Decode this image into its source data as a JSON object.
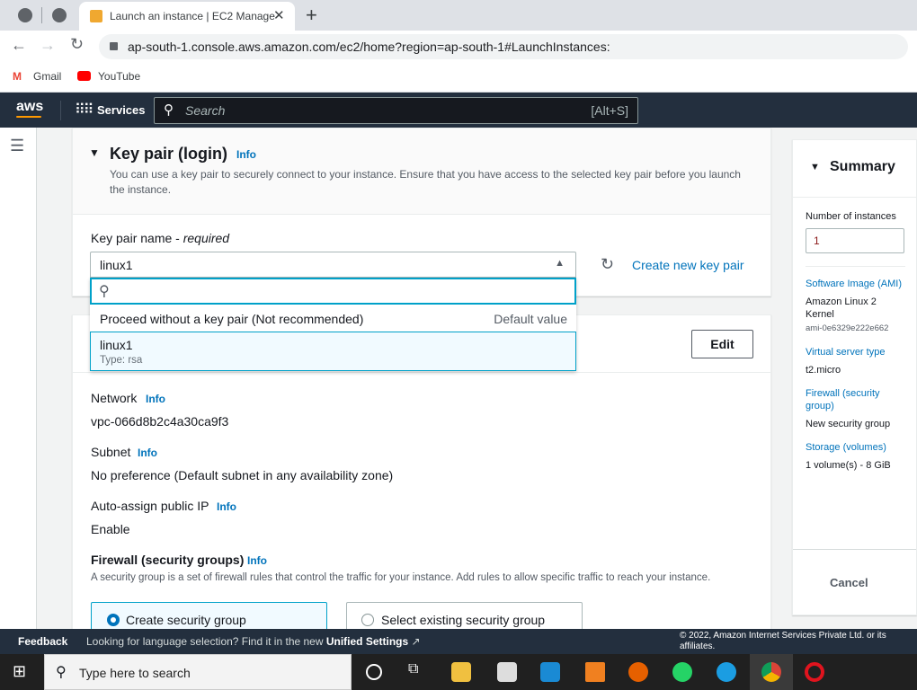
{
  "browser": {
    "tab_title": "Launch an instance | EC2 Manage",
    "url": "ap-south-1.console.aws.amazon.com/ec2/home?region=ap-south-1#LaunchInstances:",
    "bookmarks": [
      "Gmail",
      "YouTube"
    ]
  },
  "nav": {
    "logo": "aws",
    "services": "Services",
    "search_placeholder": "Search",
    "shortcut": "[Alt+S]"
  },
  "keypair": {
    "title": "Key pair (login)",
    "info": "Info",
    "description": "You can use a key pair to securely connect to your instance. Ensure that you have access to the selected key pair before you launch the instance.",
    "field_label": "Key pair name - ",
    "field_required": "required",
    "selected": "linux1",
    "refresh_icon": "refresh-icon",
    "create_link": "Create new key pair",
    "options": [
      {
        "label": "Proceed without a key pair (Not recommended)",
        "tag": "Default value"
      },
      {
        "label": "linux1",
        "sub": "Type: rsa"
      }
    ]
  },
  "network": {
    "edit": "Edit",
    "network_label": "Network",
    "network_value": "vpc-066d8b2c4a30ca9f3",
    "subnet_label": "Subnet",
    "subnet_value": "No preference (Default subnet in any availability zone)",
    "ip_label": "Auto-assign public IP",
    "ip_value": "Enable",
    "info": "Info",
    "firewall_label": "Firewall (security groups)",
    "firewall_desc": "A security group is a set of firewall rules that control the traffic for your instance. Add rules to allow specific traffic to reach your instance.",
    "radio_create": "Create security group",
    "radio_existing": "Select existing security group"
  },
  "summary": {
    "title": "Summary",
    "instances_label": "Number of instances",
    "instances_value": "1",
    "ami_label": "Software Image (AMI)",
    "ami_value": "Amazon Linux 2 Kernel",
    "ami_id": "ami-0e6329e222e662",
    "type_label": "Virtual server type",
    "type_value": "t2.micro",
    "fw_label": "Firewall (security group)",
    "fw_value": "New security group",
    "storage_label": "Storage (volumes)",
    "storage_value": "1 volume(s) - 8 GiB",
    "cancel": "Cancel"
  },
  "footer": {
    "feedback": "Feedback",
    "lang": "Looking for language selection? Find it in the new ",
    "unified": "Unified Settings",
    "copyright": "© 2022, Amazon Internet Services Private Ltd. or its affiliates."
  },
  "taskbar": {
    "search": "Type here to search"
  }
}
